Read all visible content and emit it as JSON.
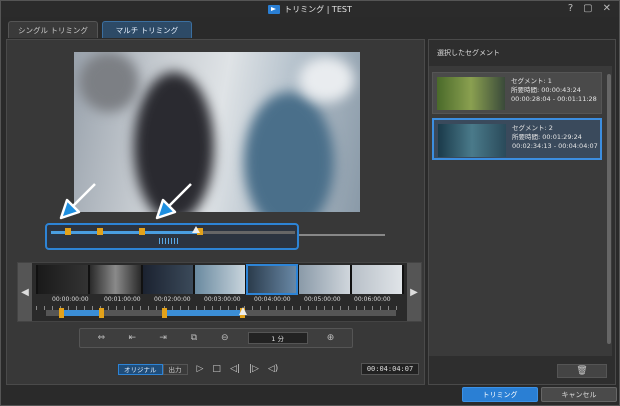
{
  "window": {
    "title": "トリミング | TEST",
    "help_glyph": "?",
    "minimize_glyph": "▢",
    "close_glyph": "✕"
  },
  "tabs": [
    {
      "label": "シングル トリミング",
      "active": false
    },
    {
      "label": "マルチ トリミング",
      "active": true
    }
  ],
  "timeline": {
    "timecodes": [
      "00:00:00:00",
      "00:01:00:00",
      "00:02:00:00",
      "00:03:00:00",
      "00:04:00:00",
      "00:05:00:00",
      "00:06:00:00"
    ],
    "zoom_label": "1 分",
    "nav_left": "◀",
    "nav_right": "▶"
  },
  "playback": {
    "mode_original": "オリジナル",
    "mode_output": "出力",
    "timecode": "00:04:04:07"
  },
  "segments_panel": {
    "title": "選択したセグメント",
    "segments": [
      {
        "name": "セグメント: 1",
        "duration": "所要時間: 00:00:43:24",
        "range": "00:00:28:04 - 00:01:11:28",
        "selected": false
      },
      {
        "name": "セグメント: 2",
        "duration": "所要時間: 00:01:29:24",
        "range": "00:02:34:13 - 00:04:04:07",
        "selected": true
      }
    ],
    "delete_glyph": "🗑"
  },
  "footer": {
    "trim_label": "トリミング",
    "cancel_label": "キャンセル"
  },
  "colors": {
    "accent": "#2a7fd4",
    "marker": "#e3a21a",
    "annotation_arrow": "#1e8fe0"
  }
}
